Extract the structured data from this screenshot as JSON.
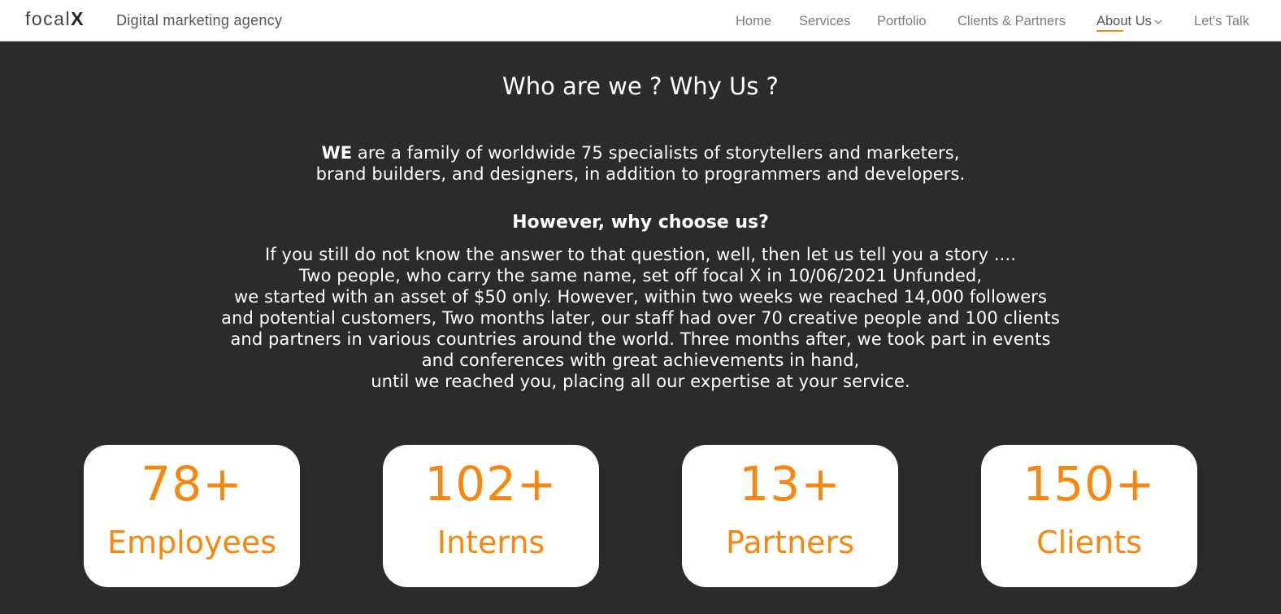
{
  "header": {
    "logo_text": "focal",
    "logo_x": "X",
    "tagline": "Digital marketing agency",
    "nav": [
      {
        "label": "Home"
      },
      {
        "label": "Services"
      },
      {
        "label": "Portfolio"
      },
      {
        "label": "Clients & Partners"
      },
      {
        "label": "About Us",
        "active": true
      },
      {
        "label": "Let's Talk"
      }
    ],
    "accent_color": "#f7870f"
  },
  "about": {
    "heading": "Who are we ? Why Us ?",
    "intro_bold": "WE",
    "intro_line1": " are a family of worldwide 75 specialists of storytellers and marketers,",
    "intro_line2": "brand builders, and designers, in addition to programmers and developers.",
    "subheading": "However, why choose us?",
    "story_lines": [
      "If you still do not know the answer to that question, well, then let us tell you a story ....",
      "Two people, who carry the same name, set off focal X in 10/06/2021 Unfunded,",
      "we started with an asset of $50 only. However, within two weeks we reached 14,000 followers",
      "and potential customers, Two months later, our staff had over 70 creative people and 100 clients",
      "and partners in various countries around the world. Three months after, we took part in events",
      "and conferences with great achievements in hand,",
      "until we reached you, placing all our expertise at your service."
    ]
  },
  "stats": [
    {
      "value": "78+",
      "label": "Employees"
    },
    {
      "value": "102+",
      "label": "Interns"
    },
    {
      "value": "13+",
      "label": "Partners"
    },
    {
      "value": "150+",
      "label": "Clients"
    }
  ],
  "colors": {
    "background": "#2b2b2b",
    "accent": "#f7870f",
    "card": "#ffffff"
  }
}
